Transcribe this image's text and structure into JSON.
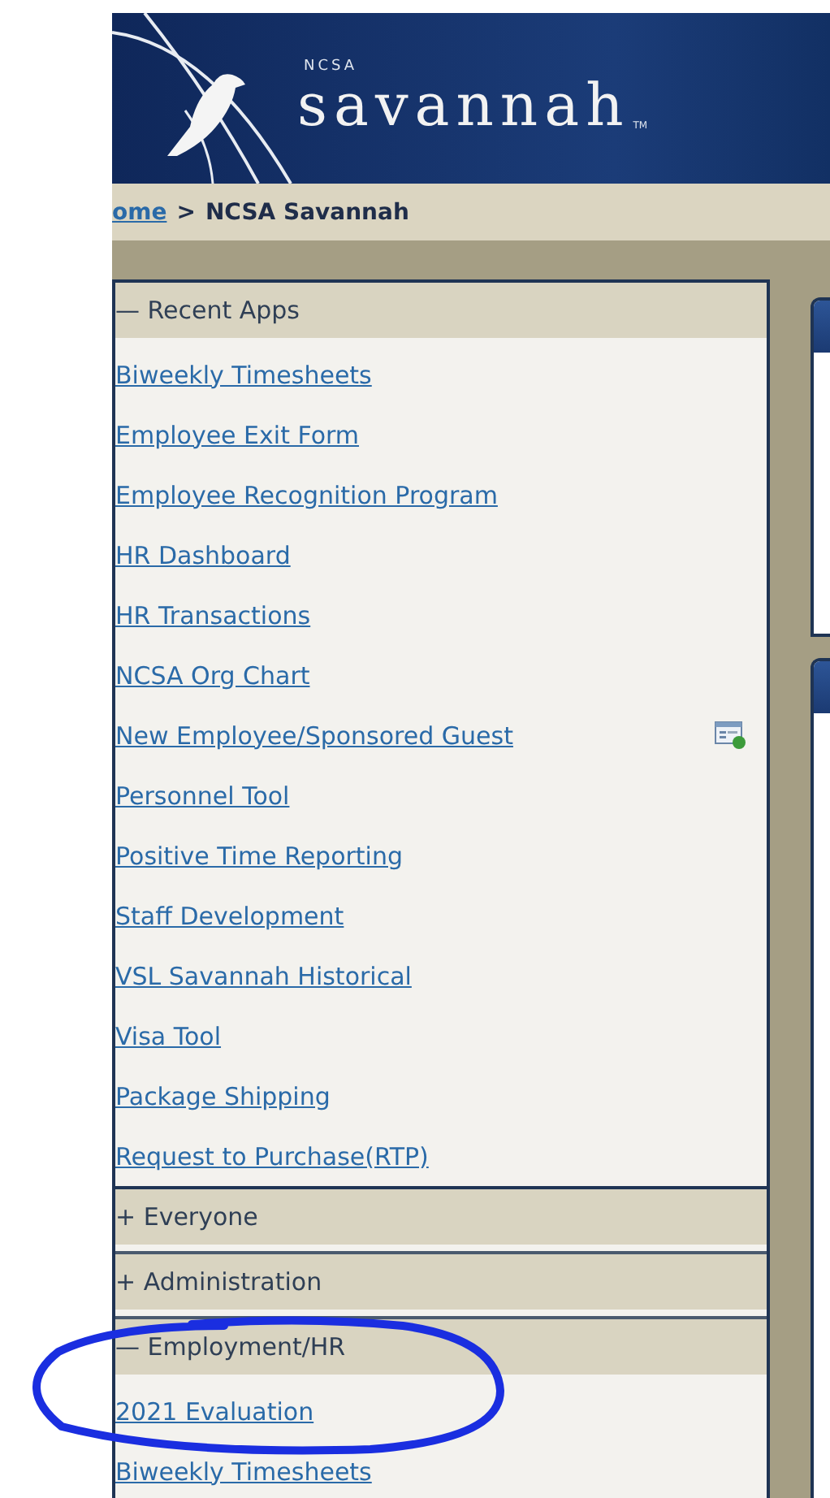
{
  "header": {
    "logo_small": "NCSA",
    "logo_name": "savannah",
    "logo_mark": "TM"
  },
  "breadcrumb": {
    "link": "ome",
    "separator": ">",
    "current": "NCSA Savannah"
  },
  "sections": [
    {
      "toggle": "—",
      "title": "Recent Apps",
      "expanded": true,
      "items": [
        {
          "label": "Biweekly Timesheets",
          "add_icon": false
        },
        {
          "label": "Employee Exit Form",
          "add_icon": false
        },
        {
          "label": "Employee Recognition Program",
          "add_icon": false
        },
        {
          "label": "HR Dashboard",
          "add_icon": false
        },
        {
          "label": "HR Transactions",
          "add_icon": false
        },
        {
          "label": "NCSA Org Chart",
          "add_icon": false
        },
        {
          "label": "New Employee/Sponsored Guest",
          "add_icon": true
        },
        {
          "label": "Personnel Tool",
          "add_icon": false
        },
        {
          "label": "Positive Time Reporting",
          "add_icon": false
        },
        {
          "label": "Staff Development",
          "add_icon": false
        },
        {
          "label": "VSL Savannah Historical",
          "add_icon": false
        },
        {
          "label": "Visa Tool",
          "add_icon": false
        },
        {
          "label": "Package Shipping",
          "add_icon": false
        },
        {
          "label": "Request to Purchase(RTP)",
          "add_icon": false
        }
      ]
    },
    {
      "toggle": "+",
      "title": "Everyone",
      "expanded": false
    },
    {
      "toggle": "+",
      "title": "Administration",
      "expanded": false
    },
    {
      "toggle": "—",
      "title": "Employment/HR",
      "expanded": true,
      "items": [
        {
          "label": "2021 Evaluation",
          "add_icon": false
        },
        {
          "label": "Biweekly Timesheets",
          "add_icon": false
        }
      ]
    }
  ]
}
